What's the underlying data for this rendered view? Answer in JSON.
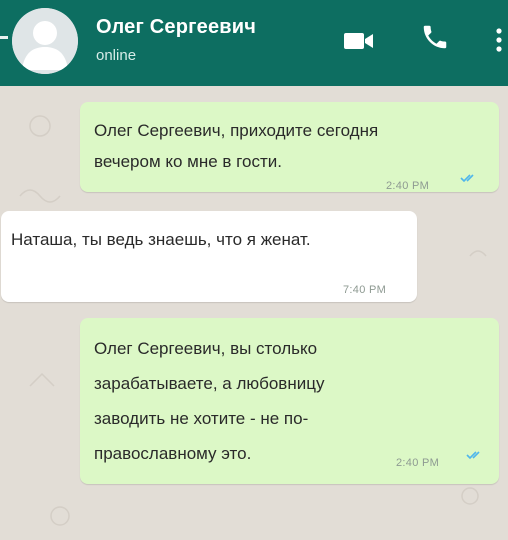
{
  "header": {
    "contact_name": "Олег Сергеевич",
    "status": "online",
    "icons": [
      "video-call-icon",
      "voice-call-icon",
      "more-vertical-icon"
    ],
    "background_color": "#0d6e61"
  },
  "messages": [
    {
      "direction": "outgoing",
      "lines": [
        "Олег Сергеевич, приходите сегодня",
        "вечером ко мне в гости."
      ],
      "time": "2:40 PM",
      "read": true
    },
    {
      "direction": "incoming",
      "lines": [
        "Наташа, ты ведь знаешь, что я женат."
      ],
      "time": "7:40 PM"
    },
    {
      "direction": "outgoing",
      "lines": [
        "Олег Сергеевич, вы столько",
        "зарабатываете, а любовницу",
        "заводить не хотите - не по-",
        "православному это."
      ],
      "time": "2:40 PM",
      "read": true
    }
  ],
  "colors": {
    "outgoing_bubble": "#dcf8c6",
    "incoming_bubble": "#ffffff",
    "chat_background": "#e2ddd6",
    "read_ticks": "#4fb6ec"
  }
}
